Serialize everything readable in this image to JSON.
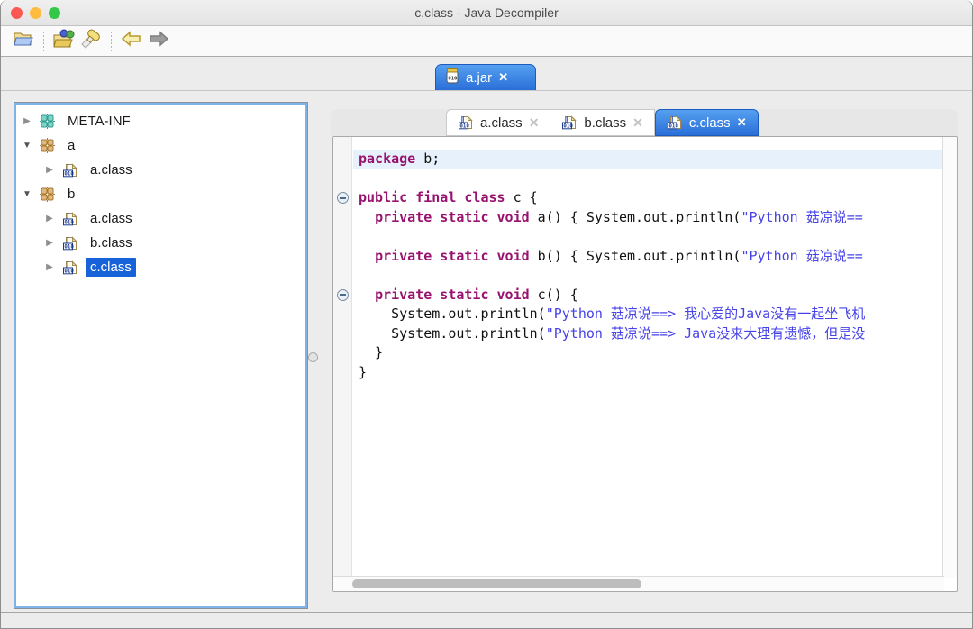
{
  "window": {
    "title": "c.class - Java Decompiler"
  },
  "titlebar_buttons": [
    "close-button",
    "minimize-button",
    "zoom-button"
  ],
  "toolbar": {
    "icons": [
      "open-file-icon",
      "open-type-icon",
      "search-icon",
      "back-icon",
      "forward-icon"
    ]
  },
  "jar_tab": {
    "label": "a.jar",
    "close": "✕",
    "icon": "jar-icon"
  },
  "tree": {
    "items": [
      {
        "label": "META-INF",
        "level": 0,
        "state": "collapsed",
        "icon": "package-teal",
        "selected": false
      },
      {
        "label": "a",
        "level": 0,
        "state": "expanded",
        "icon": "package-tan",
        "selected": false
      },
      {
        "label": "a.class",
        "level": 1,
        "state": "collapsed",
        "icon": "class-file",
        "selected": false
      },
      {
        "label": "b",
        "level": 0,
        "state": "expanded",
        "icon": "package-tan",
        "selected": false
      },
      {
        "label": "a.class",
        "level": 1,
        "state": "collapsed",
        "icon": "class-file",
        "selected": false
      },
      {
        "label": "b.class",
        "level": 1,
        "state": "collapsed",
        "icon": "class-file",
        "selected": false
      },
      {
        "label": "c.class",
        "level": 1,
        "state": "collapsed",
        "icon": "class-file",
        "selected": true
      }
    ]
  },
  "editor_tabs": [
    {
      "label": "a.class",
      "active": false,
      "close": "✕",
      "icon": "class-file"
    },
    {
      "label": "b.class",
      "active": false,
      "close": "✕",
      "icon": "class-file"
    },
    {
      "label": "c.class",
      "active": true,
      "close": "✕",
      "icon": "class-file"
    }
  ],
  "code": {
    "lines": [
      {
        "current": true,
        "segments": [
          {
            "t": "package",
            "s": "kw"
          },
          {
            "t": " b;",
            "s": "pl"
          }
        ]
      },
      {
        "segments": []
      },
      {
        "fold": true,
        "segments": [
          {
            "t": "public final class",
            "s": "kw"
          },
          {
            "t": " c {",
            "s": "pl"
          }
        ]
      },
      {
        "segments": [
          {
            "t": "  ",
            "s": "pl"
          },
          {
            "t": "private static void",
            "s": "kw"
          },
          {
            "t": " a() { System.out.println(",
            "s": "pl"
          },
          {
            "t": "\"Python 菇凉说==",
            "s": "str"
          }
        ]
      },
      {
        "segments": []
      },
      {
        "segments": [
          {
            "t": "  ",
            "s": "pl"
          },
          {
            "t": "private static void",
            "s": "kw"
          },
          {
            "t": " b() { System.out.println(",
            "s": "pl"
          },
          {
            "t": "\"Python 菇凉说==",
            "s": "str"
          }
        ]
      },
      {
        "segments": []
      },
      {
        "fold": true,
        "segments": [
          {
            "t": "  ",
            "s": "pl"
          },
          {
            "t": "private static void",
            "s": "kw"
          },
          {
            "t": " c() {",
            "s": "pl"
          }
        ]
      },
      {
        "segments": [
          {
            "t": "    System.out.println(",
            "s": "pl"
          },
          {
            "t": "\"Python 菇凉说==> 我心爱的Java没有一起坐飞机",
            "s": "str"
          }
        ]
      },
      {
        "segments": [
          {
            "t": "    System.out.println(",
            "s": "pl"
          },
          {
            "t": "\"Python 菇凉说==> Java没来大理有遗憾，但是没",
            "s": "str"
          }
        ]
      },
      {
        "segments": [
          {
            "t": "  }",
            "s": "pl"
          }
        ]
      },
      {
        "segments": [
          {
            "t": "}",
            "s": "pl"
          }
        ]
      }
    ]
  },
  "colors": {
    "traffic_red": "#FC5753",
    "traffic_yellow": "#FDBC40",
    "traffic_green": "#33C748",
    "keyword": "#98136F",
    "string": "#4642E8",
    "selection_blue": "#1762D9",
    "tab_active_top": "#55A0F0",
    "tab_active_bottom": "#2A6FD8",
    "current_line_highlight": "#E6F1FC"
  }
}
